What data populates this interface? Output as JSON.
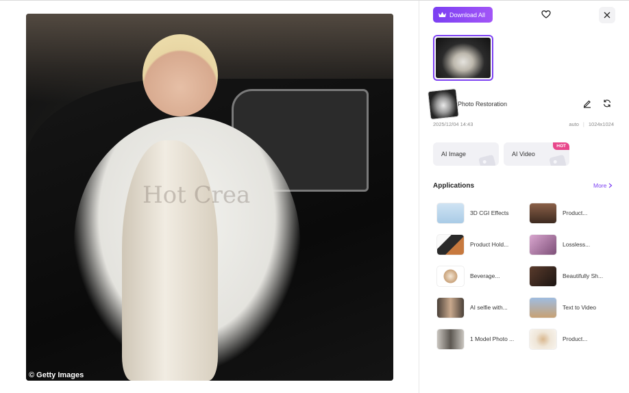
{
  "viewer": {
    "watermark": "© Getty Images",
    "faint_overlay": "Hot Crea"
  },
  "toolbar": {
    "download_all_label": "Download All",
    "brand_color": "#7b3ff2"
  },
  "history": {
    "item_title": "Photo Restoration",
    "date": "2025/12/04 14:43",
    "mode": "auto",
    "resolution": "1024x1024"
  },
  "ai_cards": [
    {
      "label": "AI Image",
      "badge": ""
    },
    {
      "label": "AI Video",
      "badge": "HOT"
    }
  ],
  "applications": {
    "title": "Applications",
    "more_label": "More",
    "items": [
      {
        "label": "3D CGI Effects",
        "color": "#a9cbe6"
      },
      {
        "label": "Product...",
        "color": "#6b4a35"
      },
      {
        "label": "Product Hold...",
        "color": "#c7793e"
      },
      {
        "label": "Lossless...",
        "color": "#b07aa6"
      },
      {
        "label": "Beverage...",
        "color": "#c9a27a"
      },
      {
        "label": "Beautifully Sh...",
        "color": "#3a2a22"
      },
      {
        "label": "AI selfie with...",
        "color": "#6f6152"
      },
      {
        "label": "Text to Video",
        "color": "#7fa1c8"
      },
      {
        "label": "1 Model Photo ...",
        "color": "#8b8a86"
      },
      {
        "label": "Product...",
        "color": "#e8dccb"
      }
    ]
  }
}
